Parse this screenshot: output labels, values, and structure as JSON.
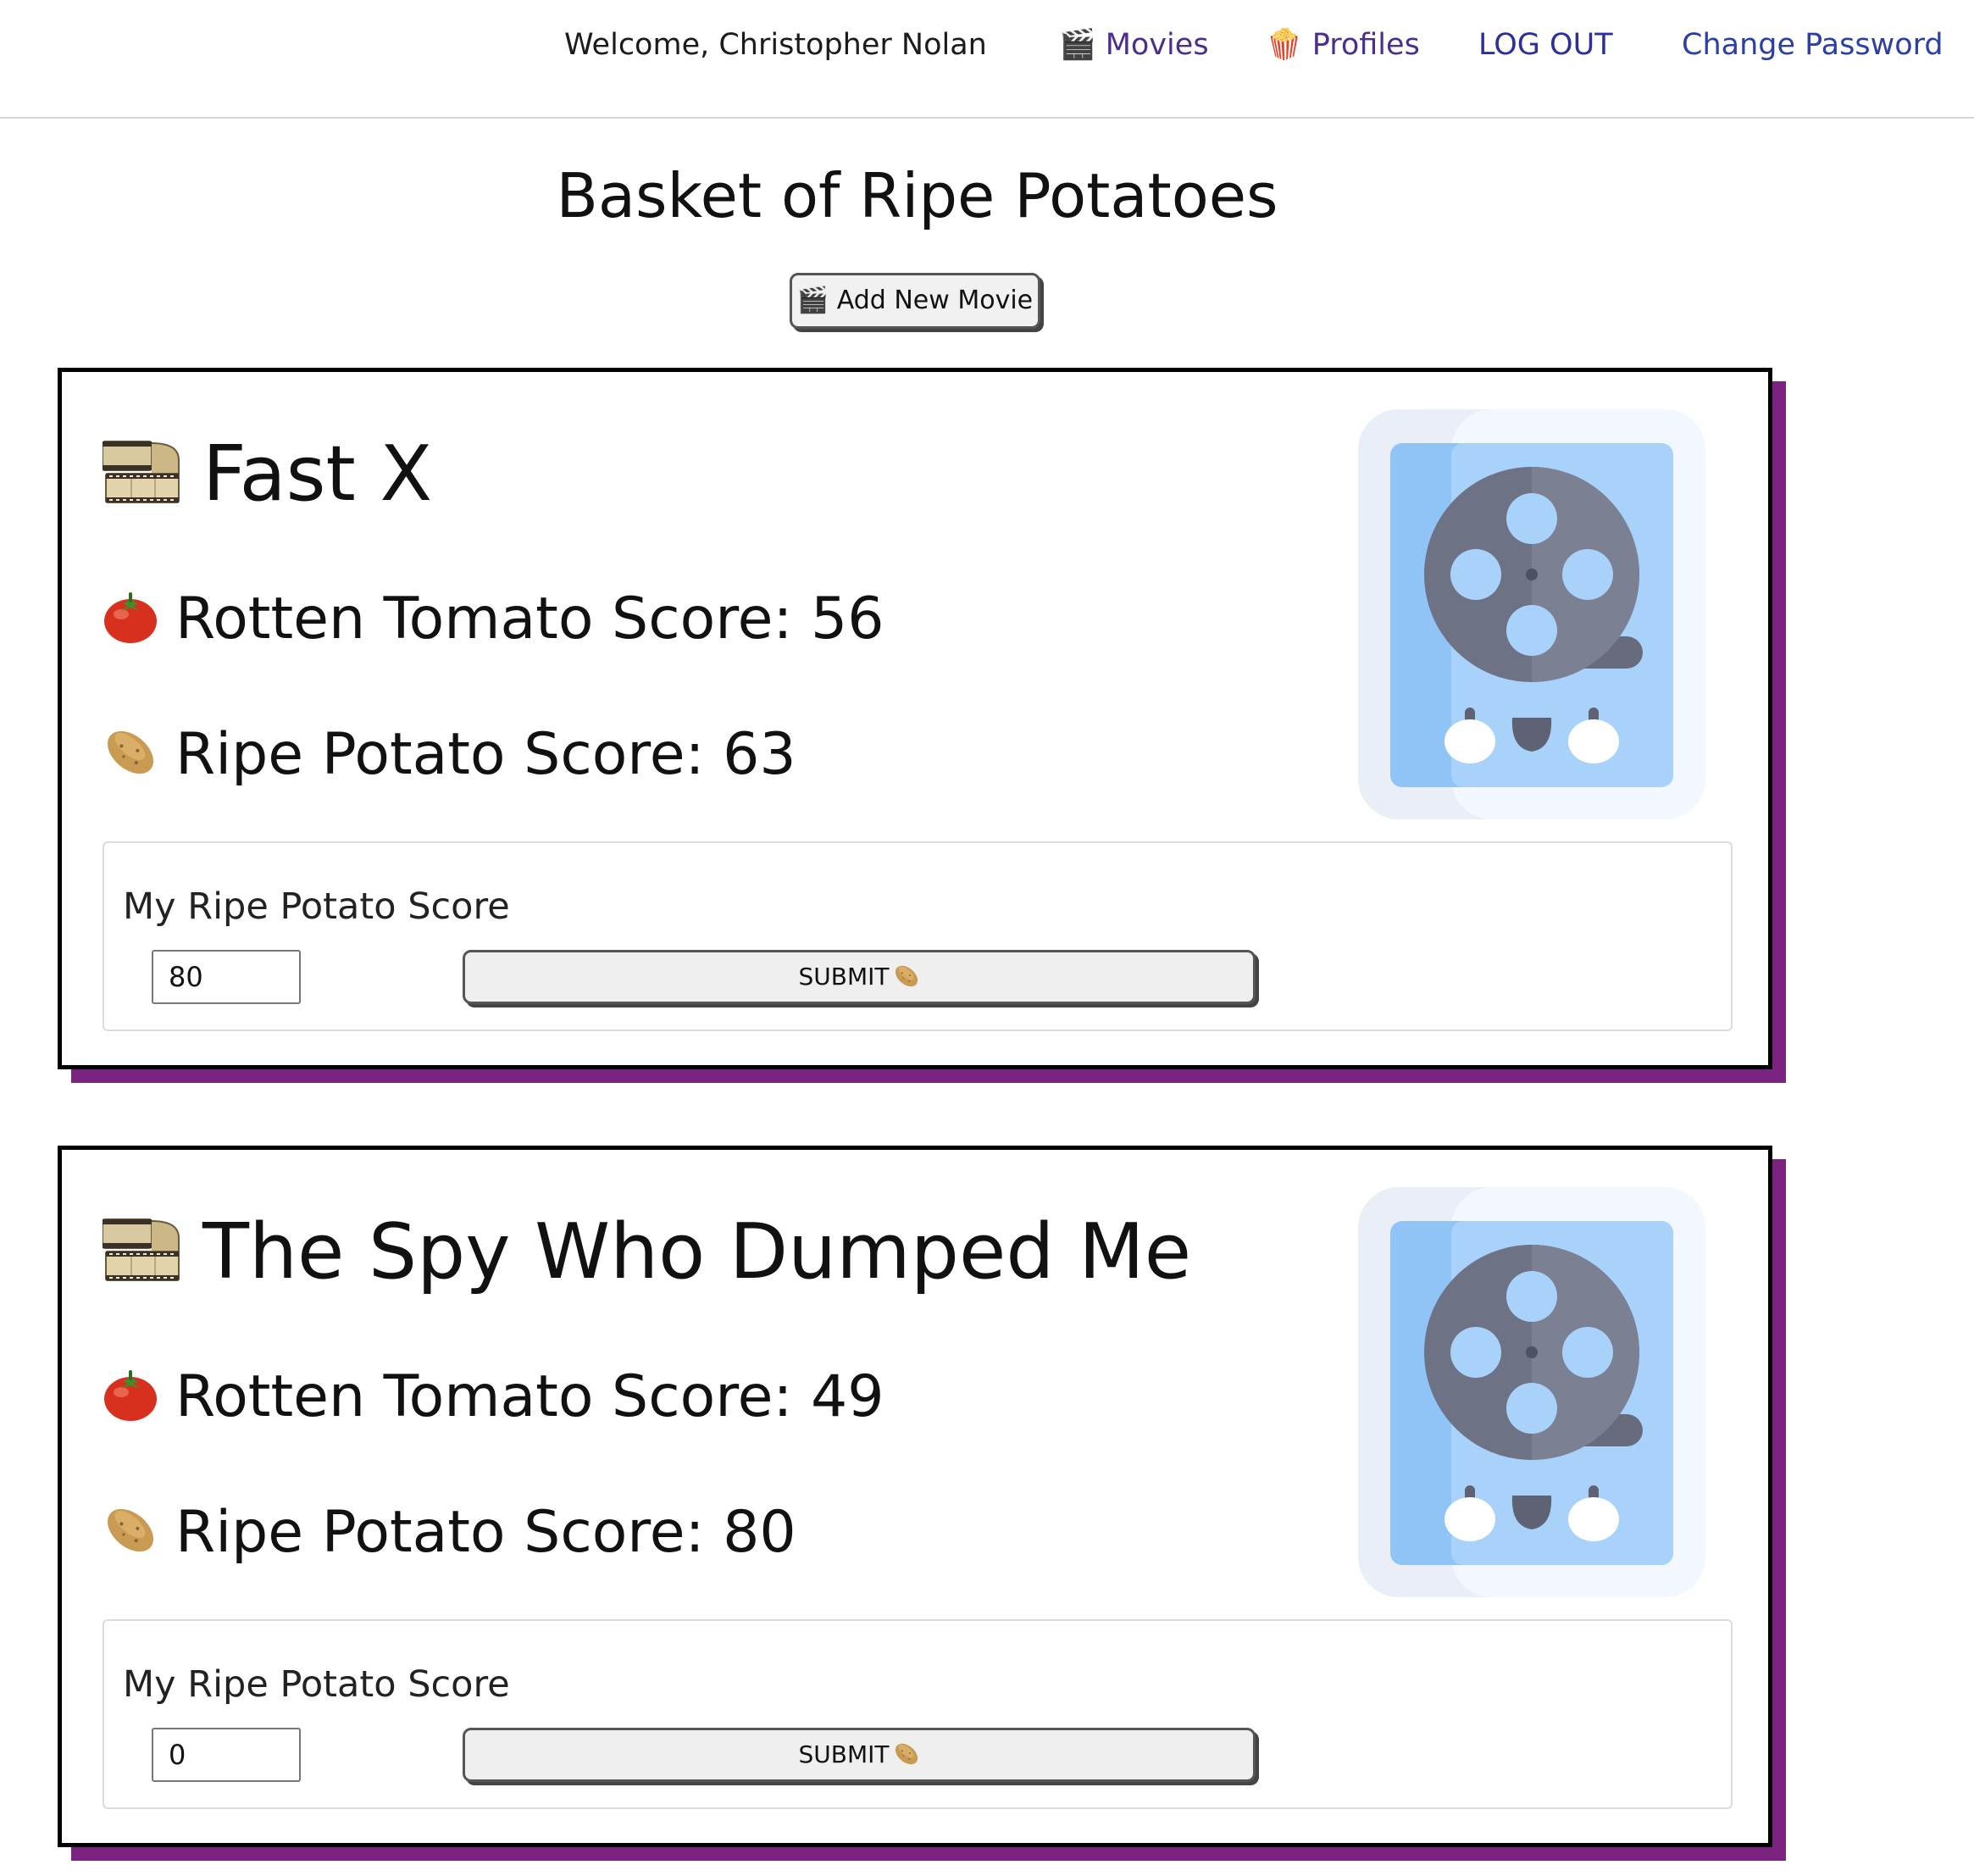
{
  "nav": {
    "welcome": "Welcome, Christopher Nolan",
    "movies_icon": "clapper-icon",
    "movies_emoji": "🎬",
    "movies": "Movies",
    "profiles_icon": "popcorn-icon",
    "profiles_emoji": "🍿",
    "profiles": "Profiles",
    "logout": "LOG OUT",
    "change_password": "Change Password"
  },
  "page": {
    "title": "Basket of Ripe Potatoes",
    "add_movie": "🎬 Add New Movie"
  },
  "movies": [
    {
      "title": "Fast X",
      "rotten_tomato_label": "Rotten Tomato Score: 56",
      "ripe_potato_label": "Ripe Potato Score: 63",
      "form_label": "My Ripe Potato Score",
      "my_score_value": "80",
      "submit_label": "SUBMIT"
    },
    {
      "title": "The Spy Who Dumped Me",
      "rotten_tomato_label": "Rotten Tomato Score: 49",
      "ripe_potato_label": "Ripe Potato Score: 80",
      "form_label": "My Ripe Potato Score",
      "my_score_value": "0",
      "submit_label": "SUBMIT"
    }
  ],
  "colors": {
    "card_shadow": "#7a237f",
    "nav_link_purple": "#4a2f8c",
    "nav_link_blue": "#2c3fa5"
  }
}
